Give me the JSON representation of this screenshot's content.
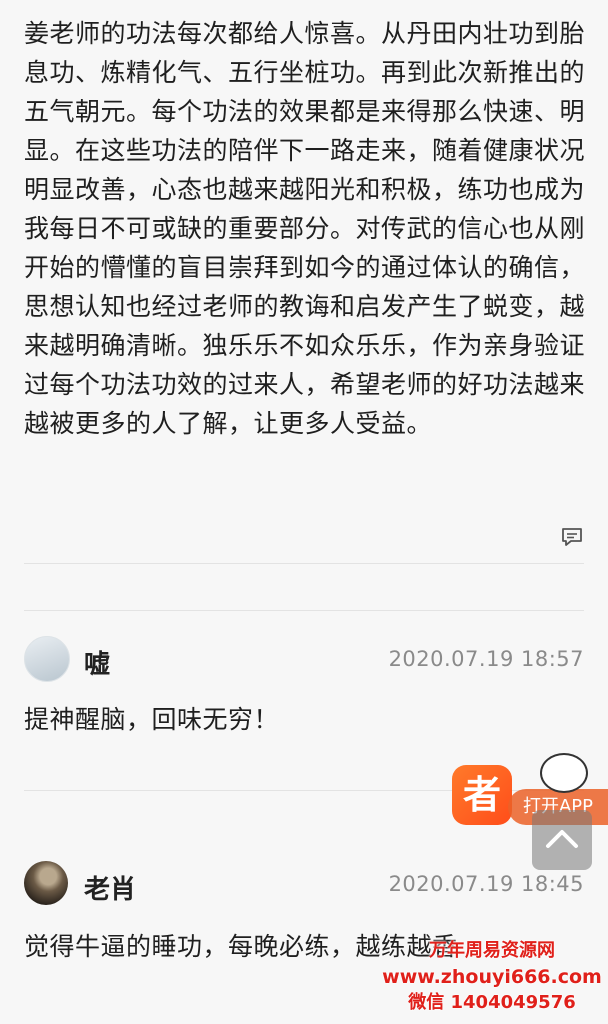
{
  "post": {
    "body": "姜老师的功法每次都给人惊喜。从丹田内壮功到胎息功、炼精化气、五行坐桩功。再到此次新推出的五气朝元。每个功法的效果都是来得那么快速、明显。在这些功法的陪伴下一路走来，随着健康状况明显改善，心态也越来越阳光和积极，练功也成为我每日不可或缺的重要部分。对传武的信心也从刚开始的懵懂的盲目崇拜到如今的通过体认的确信，思想认知也经过老师的教诲和启发产生了蜕变，越来越明确清晰。独乐乐不如众乐乐，作为亲身验证过每个功法功效的过来人，希望老师的好功法越来越被更多的人了解，让更多人受益。"
  },
  "comments": [
    {
      "username": "嘘",
      "timestamp": "2020.07.19 18:57",
      "text": "提神醒脑，回味无穷！"
    },
    {
      "username": "老肖",
      "timestamp": "2020.07.19 18:45",
      "text": "觉得牛逼的睡功，每晚必练，越练越香"
    }
  ],
  "app_badge": {
    "logo_char": "者",
    "label": "打开APP"
  },
  "watermark": {
    "line1": "万年周易资源网",
    "line2": "www.zhouyi666.com",
    "line3": "微信 1404049576"
  }
}
